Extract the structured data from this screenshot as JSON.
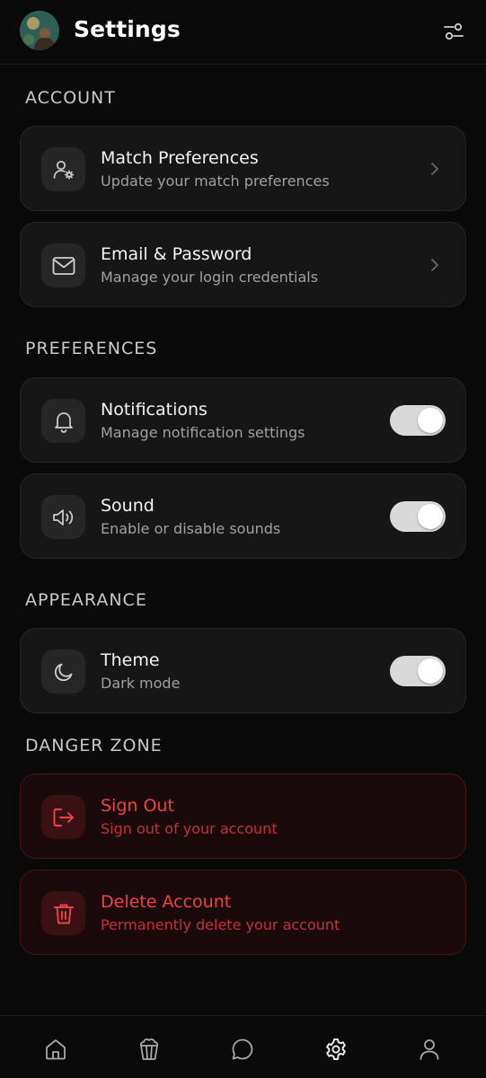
{
  "header": {
    "title": "Settings",
    "avatar_icon": "user-avatar",
    "filter_icon": "sliders-icon"
  },
  "sections": {
    "account": "ACCOUNT",
    "preferences": "PREFERENCES",
    "appearance": "APPEARANCE",
    "danger": "DANGER ZONE"
  },
  "items": {
    "match_preferences": {
      "title": "Match Preferences",
      "subtitle": "Update your match preferences",
      "icon": "user-gear-icon"
    },
    "email_password": {
      "title": "Email & Password",
      "subtitle": "Manage your login credentials",
      "icon": "mail-icon"
    },
    "notifications": {
      "title": "Notifications",
      "subtitle": "Manage notification settings",
      "icon": "bell-icon",
      "enabled": true
    },
    "sound": {
      "title": "Sound",
      "subtitle": "Enable or disable sounds",
      "icon": "volume-icon",
      "enabled": true
    },
    "theme": {
      "title": "Theme",
      "subtitle": "Dark mode",
      "icon": "moon-icon",
      "enabled": true
    },
    "sign_out": {
      "title": "Sign Out",
      "subtitle": "Sign out of your account",
      "icon": "logout-icon"
    },
    "delete_account": {
      "title": "Delete Account",
      "subtitle": "Permanently delete your account",
      "icon": "trash-icon"
    }
  },
  "bottom_nav": [
    {
      "name": "home",
      "icon": "home-icon",
      "active": false
    },
    {
      "name": "popcorn",
      "icon": "popcorn-icon",
      "active": false
    },
    {
      "name": "chat",
      "icon": "chat-icon",
      "active": false
    },
    {
      "name": "settings",
      "icon": "gear-icon",
      "active": true
    },
    {
      "name": "profile",
      "icon": "user-icon",
      "active": false
    }
  ],
  "colors": {
    "background": "#0a0a0a",
    "card": "#161616",
    "danger": "#ef4444",
    "toggle_on": "#d9d9d9"
  }
}
